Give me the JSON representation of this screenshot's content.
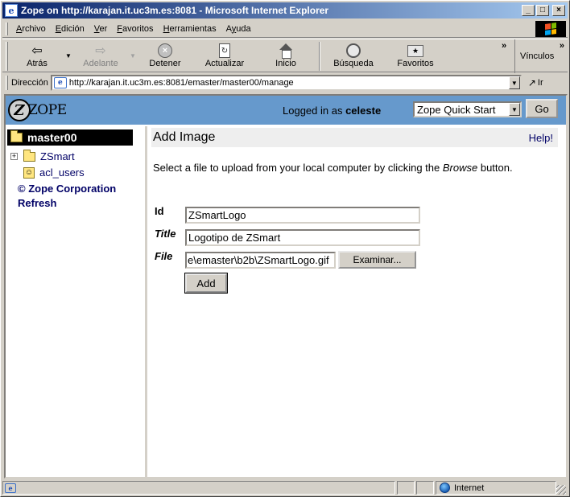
{
  "window": {
    "title": "Zope on http://karajan.it.uc3m.es:8081 - Microsoft Internet Explorer",
    "controls": {
      "minimize": "_",
      "maximize": "□",
      "close": "×"
    }
  },
  "menubar": {
    "items": [
      {
        "label": "Archivo",
        "accel": "A",
        "rest": "rchivo"
      },
      {
        "label": "Edición",
        "accel": "E",
        "rest": "dición"
      },
      {
        "label": "Ver",
        "accel": "V",
        "rest": "er"
      },
      {
        "label": "Favoritos",
        "accel": "F",
        "rest": "avoritos"
      },
      {
        "label": "Herramientas",
        "accel": "H",
        "rest": "erramientas"
      },
      {
        "label": "Ayuda",
        "accel": "y",
        "pre": "A",
        "rest": "uda"
      }
    ]
  },
  "toolbar": {
    "back": {
      "label": "Atrás",
      "icon": "back-arrow-icon"
    },
    "forward": {
      "label": "Adelante",
      "icon": "forward-arrow-icon",
      "disabled": true
    },
    "stop": {
      "label": "Detener",
      "icon": "stop-icon"
    },
    "refresh": {
      "label": "Actualizar",
      "icon": "refresh-icon"
    },
    "home": {
      "label": "Inicio",
      "icon": "home-icon"
    },
    "search": {
      "label": "Búsqueda",
      "icon": "search-icon"
    },
    "favorites": {
      "label": "Favoritos",
      "icon": "favorites-icon"
    },
    "links": {
      "label": "Vínculos"
    }
  },
  "addressbar": {
    "label": "Dirección",
    "url": "http://karajan.it.uc3m.es:8081/emaster/master00/manage",
    "go_label": "Ir"
  },
  "zope_header": {
    "logo_text": "ZOPE",
    "logged_in_prefix": "Logged in as",
    "username": "celeste",
    "quick_start_selected": "Zope Quick Start",
    "go_button": "Go"
  },
  "tree": {
    "root": "master00",
    "items": [
      {
        "label": "ZSmart",
        "expandable": true,
        "icon": "folder-icon"
      },
      {
        "label": "acl_users",
        "expandable": false,
        "icon": "user-folder-icon"
      }
    ],
    "copyright": "© Zope Corporation",
    "refresh": "Refresh"
  },
  "main": {
    "section_title": "Add Image",
    "help_link": "Help!",
    "intro_before": "Select a file to upload from your local computer by clicking the",
    "intro_emphasis": "Browse",
    "intro_after": "button.",
    "fields": {
      "id_label": "Id",
      "id_value": "ZSmartLogo",
      "title_label": "Title",
      "title_value": "Logotipo de ZSmart",
      "file_label": "File",
      "file_value": "e\\emaster\\b2b\\ZSmartLogo.gif",
      "browse_button": "Examinar..."
    },
    "add_button": "Add"
  },
  "statusbar": {
    "zone": "Internet"
  },
  "colors": {
    "zope_header_bg": "#6699cc",
    "titlebar_start": "#0a246a",
    "titlebar_end": "#a6caf0",
    "link_color": "#000066",
    "section_bar_bg": "#eeeeee"
  }
}
